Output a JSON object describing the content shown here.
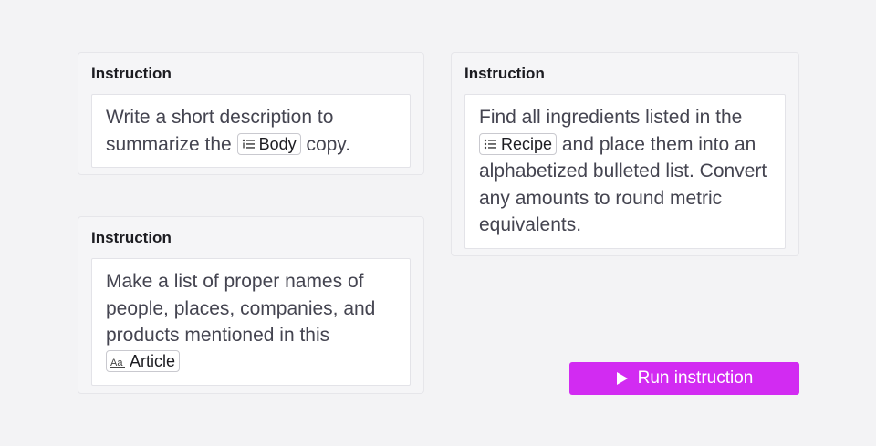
{
  "cards": [
    {
      "title": "Instruction",
      "text_before": "Write a short description to summarize the",
      "chip_label": "Body",
      "chip_icon": "list-icon",
      "text_after": "copy."
    },
    {
      "title": "Instruction",
      "text_before": "Find all ingredients listed in the",
      "chip_label": "Recipe",
      "chip_icon": "list-icon",
      "text_after": "and place them into an alphabetized bulleted list. Convert any amounts to round metric equivalents."
    },
    {
      "title": "Instruction",
      "text_before": "Make a list of proper names of people, places, companies, and products mentioned in this",
      "chip_label": "Article",
      "chip_icon": "text-format-icon",
      "text_after": ""
    }
  ],
  "run_button": {
    "label": "Run instruction",
    "icon": "play-icon",
    "color": "#d22bf2"
  }
}
